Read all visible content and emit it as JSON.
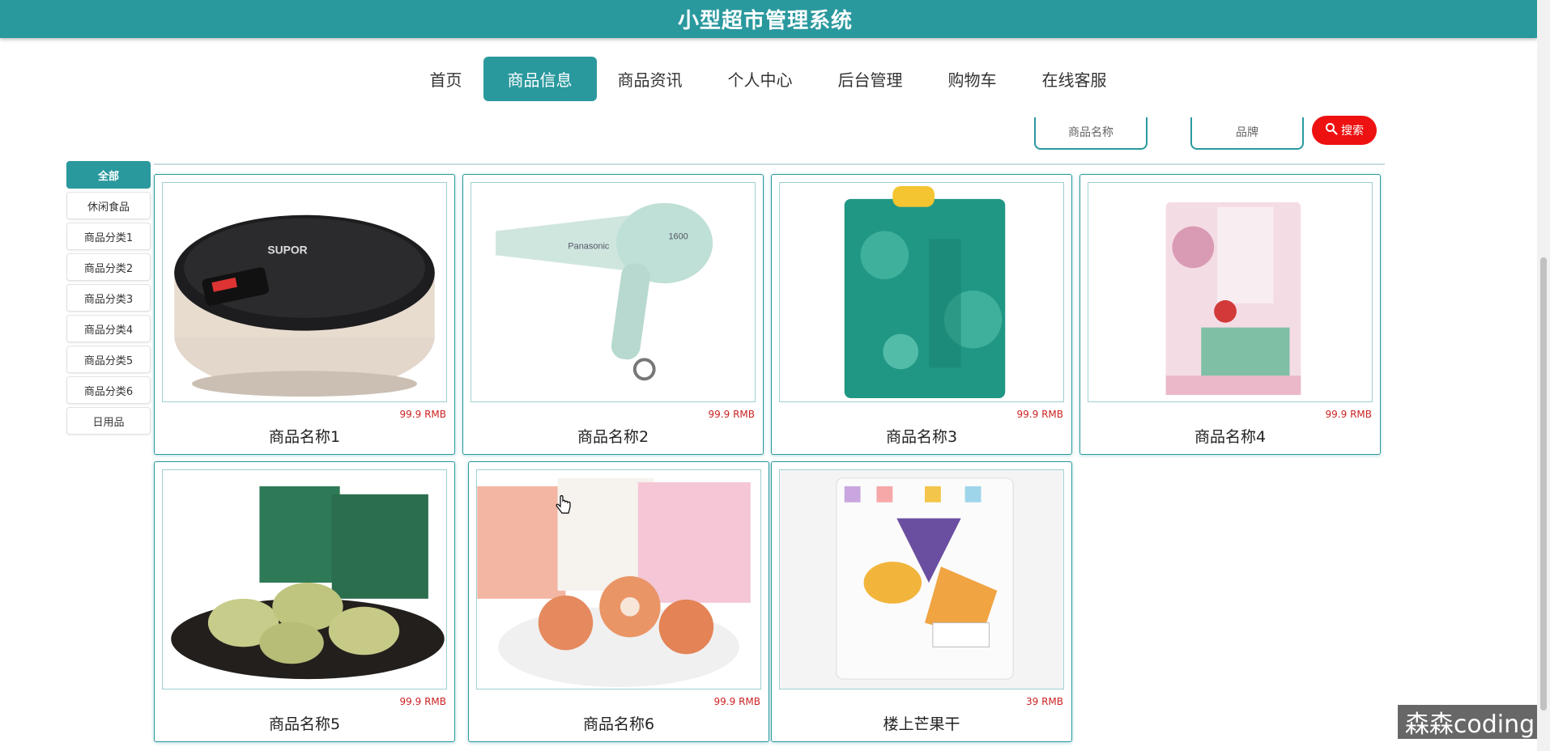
{
  "header": {
    "title": "小型超市管理系统"
  },
  "nav": {
    "items": [
      {
        "label": "首页",
        "active": false
      },
      {
        "label": "商品信息",
        "active": true
      },
      {
        "label": "商品资讯",
        "active": false
      },
      {
        "label": "个人中心",
        "active": false
      },
      {
        "label": "后台管理",
        "active": false
      },
      {
        "label": "购物车",
        "active": false
      },
      {
        "label": "在线客服",
        "active": false
      }
    ]
  },
  "search": {
    "name_placeholder": "商品名称",
    "brand_placeholder": "品牌",
    "button_label": "搜索",
    "button_icon": "search-icon",
    "button_color": "#ee1111"
  },
  "sidebar": {
    "items": [
      {
        "label": "全部",
        "active": true
      },
      {
        "label": "休闲食品",
        "active": false
      },
      {
        "label": "商品分类1",
        "active": false
      },
      {
        "label": "商品分类2",
        "active": false
      },
      {
        "label": "商品分类3",
        "active": false
      },
      {
        "label": "商品分类4",
        "active": false
      },
      {
        "label": "商品分类5",
        "active": false
      },
      {
        "label": "商品分类6",
        "active": false
      },
      {
        "label": "日用品",
        "active": false
      }
    ]
  },
  "products": [
    {
      "name": "商品名称1",
      "price": "99.9 RMB",
      "image": "rice-cooker"
    },
    {
      "name": "商品名称2",
      "price": "99.9 RMB",
      "image": "hair-dryer"
    },
    {
      "name": "商品名称3",
      "price": "99.9 RMB",
      "image": "rice-bag-green"
    },
    {
      "name": "商品名称4",
      "price": "99.9 RMB",
      "image": "rice-bag-pink"
    },
    {
      "name": "商品名称5",
      "price": "99.9 RMB",
      "image": "pastry-plate"
    },
    {
      "name": "商品名称6",
      "price": "99.9 RMB",
      "image": "shrimp-chips"
    },
    {
      "name": "楼上芒果干",
      "price": "39 RMB",
      "image": "dried-mango"
    }
  ],
  "watermark": {
    "text": "森森coding"
  },
  "colors": {
    "primary": "#2a999e",
    "price": "#cc2222"
  }
}
